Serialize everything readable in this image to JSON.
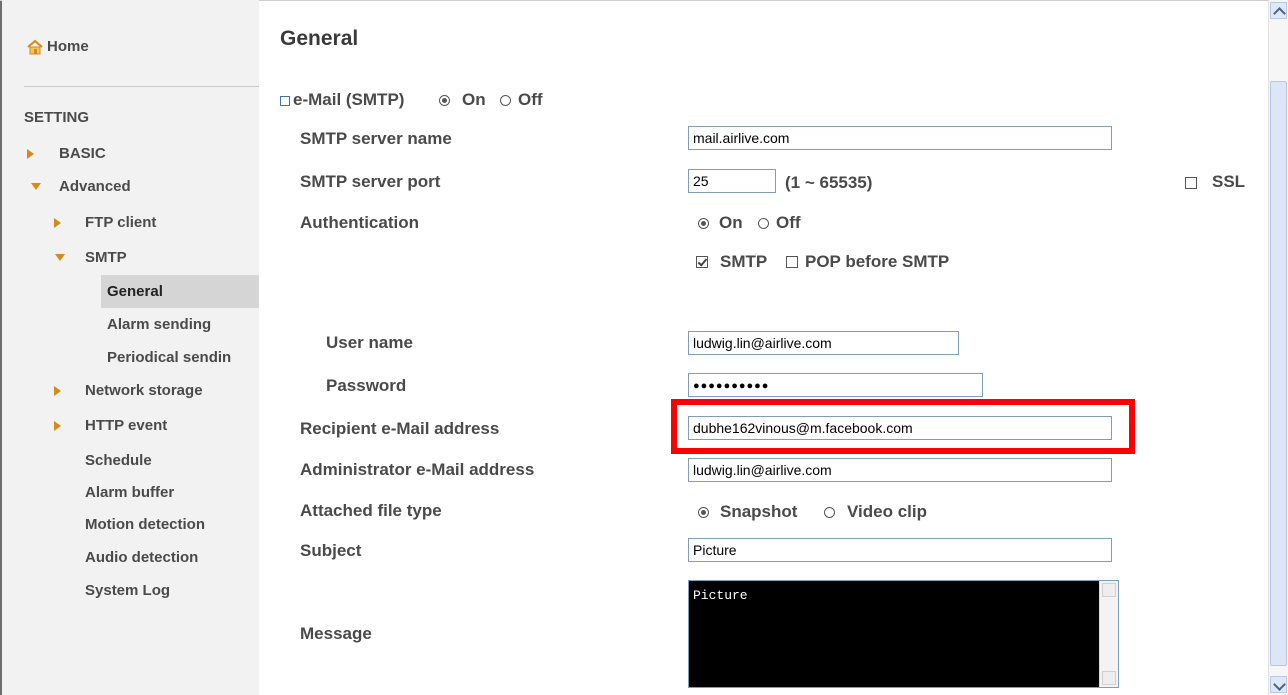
{
  "sidebar": {
    "home": "Home",
    "setting": "SETTING",
    "basic": "BASIC",
    "advanced": "Advanced",
    "ftp_client": "FTP client",
    "smtp": "SMTP",
    "general": "General",
    "alarm_sending": "Alarm sending",
    "periodical_sending": "Periodical sendin",
    "network_storage": "Network storage",
    "http_event": "HTTP event",
    "schedule": "Schedule",
    "alarm_buffer": "Alarm buffer",
    "motion_detection": "Motion detection",
    "audio_detection": "Audio detection",
    "system_log": "System Log"
  },
  "main": {
    "title": "General",
    "email_smtp_label": "e-Mail (SMTP)",
    "on": "On",
    "off": "Off",
    "smtp_server_name_label": "SMTP server name",
    "smtp_server_name_value": "mail.airlive.com",
    "smtp_server_port_label": "SMTP server port",
    "smtp_server_port_value": "25",
    "port_range": "(1 ~ 65535)",
    "ssl": "SSL",
    "authentication_label": "Authentication",
    "auth_smtp": "SMTP",
    "auth_pop": "POP before SMTP",
    "user_name_label": "User name",
    "user_name_value": "ludwig.lin@airlive.com",
    "password_label": "Password",
    "password_value": "●●●●●●●●●●",
    "recipient_label": "Recipient e-Mail address",
    "recipient_value": "dubhe162vinous@m.facebook.com",
    "admin_label": "Administrator e-Mail address",
    "admin_value": "ludwig.lin@airlive.com",
    "attached_label": "Attached file type",
    "snapshot": "Snapshot",
    "video_clip": "Video clip",
    "subject_label": "Subject",
    "subject_value": "Picture",
    "message_label": "Message",
    "message_value": "Picture"
  },
  "colors": {
    "sidebar_bg": "#f2f2f2",
    "selected_bg": "#d5d5d5",
    "arrow": "#d58a1a",
    "highlight": "#ff0000"
  }
}
